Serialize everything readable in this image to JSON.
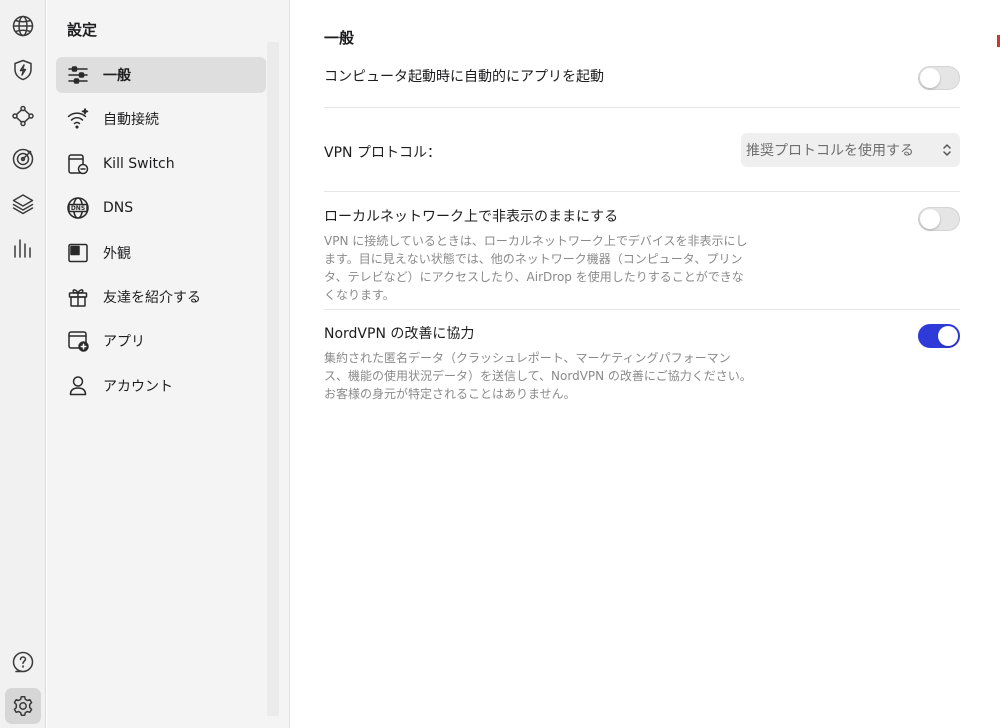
{
  "sidebar": {
    "title": "設定",
    "items": [
      {
        "label": "一般",
        "icon": "sliders-icon",
        "active": true
      },
      {
        "label": "自動接続",
        "icon": "wifi-auto-icon",
        "active": false
      },
      {
        "label": "Kill Switch",
        "icon": "kill-switch-icon",
        "active": false
      },
      {
        "label": "DNS",
        "icon": "dns-globe-icon",
        "active": false
      },
      {
        "label": "外観",
        "icon": "appearance-icon",
        "active": false
      },
      {
        "label": "友達を紹介する",
        "icon": "gift-icon",
        "active": false
      },
      {
        "label": "アプリ",
        "icon": "app-add-icon",
        "active": false
      },
      {
        "label": "アカウント",
        "icon": "person-icon",
        "active": false
      }
    ]
  },
  "rail": {
    "icons": [
      "globe-icon",
      "shield-bolt-icon",
      "meshnet-icon",
      "target-icon",
      "layers-icon",
      "stats-icon",
      "help-icon",
      "settings-gear-icon"
    ]
  },
  "main": {
    "section_title": "一般",
    "launch_at_startup": {
      "title": "コンピュータ起動時に自動的にアプリを起動",
      "enabled": false
    },
    "vpn_protocol": {
      "title": "VPN プロトコル：",
      "selected": "推奨プロトコルを使用する"
    },
    "invisible_lan": {
      "title": "ローカルネットワーク上で非表示のままにする",
      "description": "VPN に接続しているときは、ローカルネットワーク上でデバイスを非表示にします。目に見えない状態では、他のネットワーク機器（コンピュータ、プリンタ、テレビなど）にアクセスしたり、AirDrop を使用したりすることができなくなります。",
      "enabled": false
    },
    "improve_nordvpn": {
      "title": "NordVPN の改善に協力",
      "description": "集約された匿名データ（クラッシュレポート、マーケティングパフォーマンス、機能の使用状況データ）を送信して、NordVPN の改善にご協力ください。お客様の身元が特定されることはありません。",
      "enabled": true
    }
  },
  "colors": {
    "accent": "#2f3bd9",
    "sidebar_bg": "#f4f4f4",
    "rail_bg": "#f1f1f1",
    "selected_bg": "#dedede"
  }
}
